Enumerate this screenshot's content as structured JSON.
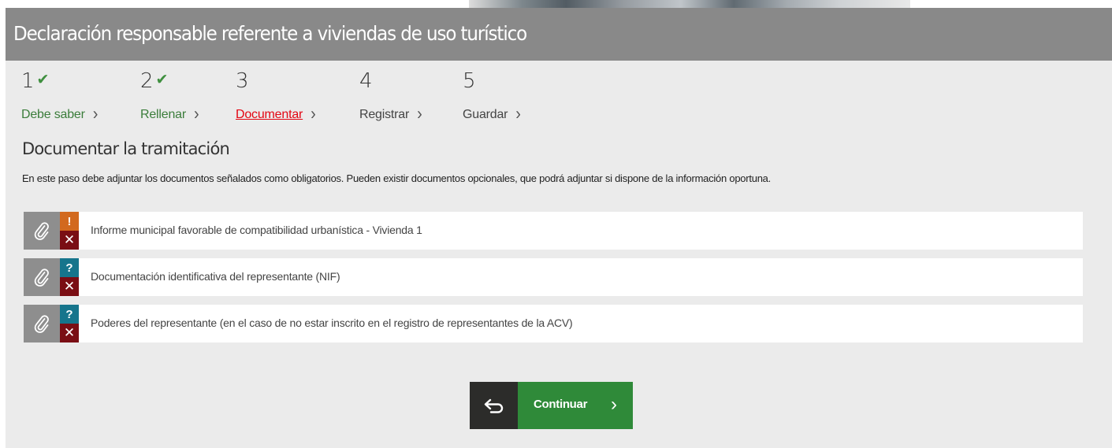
{
  "header": {
    "title": "Declaración responsable referente a viviendas de uso turístico"
  },
  "steps": [
    {
      "number": "1",
      "label": "Debe saber",
      "state": "done",
      "icon": "check-icon"
    },
    {
      "number": "2",
      "label": "Rellenar",
      "state": "done",
      "icon": "check-icon"
    },
    {
      "number": "3",
      "label": "Documentar",
      "state": "current"
    },
    {
      "number": "4",
      "label": "Registrar",
      "state": "pending"
    },
    {
      "number": "5",
      "label": "Guardar",
      "state": "pending"
    }
  ],
  "section": {
    "title": "Documentar la tramitación",
    "description": "En este paso debe adjuntar los documentos señalados como obligatorios. Pueden existir documentos opcionales, que podrá adjuntar si dispone de la información oportuna."
  },
  "documents": [
    {
      "label": "Informe municipal favorable de compatibilidad urbanística - Vivienda 1",
      "status": "required",
      "status_symbol": "!",
      "remove_symbol": "✕"
    },
    {
      "label": "Documentación identificativa del representante (NIF)",
      "status": "optional",
      "status_symbol": "?",
      "remove_symbol": "✕"
    },
    {
      "label": "Poderes del representante (en el caso de no estar inscrito en el registro de representantes de la ACV)",
      "status": "optional",
      "status_symbol": "?",
      "remove_symbol": "✕"
    }
  ],
  "actions": {
    "continue_label": "Continuar",
    "continue_arrow": "›",
    "back_icon": "back-arrow-icon"
  },
  "colors": {
    "header_bg": "#898989",
    "panel_bg": "#ebebeb",
    "done": "#3b7d3b",
    "current": "#e30613",
    "required_badge": "#d2691e",
    "optional_badge": "#16758c",
    "remove": "#7a0e14",
    "continue_bg": "#2f8a39",
    "back_bg": "#2c2c2a"
  }
}
